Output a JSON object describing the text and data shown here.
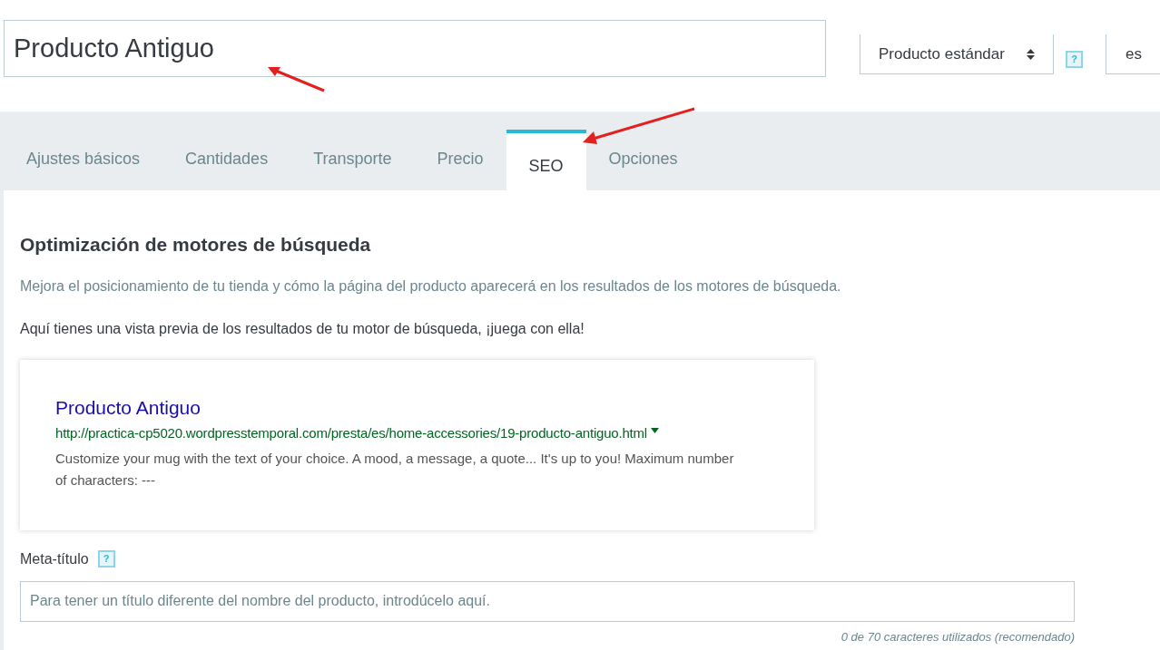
{
  "product_name": {
    "value": "Producto Antiguo"
  },
  "product_type": {
    "value": "Producto estándar",
    "help": "?"
  },
  "language": {
    "value": "es"
  },
  "tabs": [
    {
      "label": "Ajustes básicos",
      "selected": false
    },
    {
      "label": "Cantidades",
      "selected": false
    },
    {
      "label": "Transporte",
      "selected": false
    },
    {
      "label": "Precio",
      "selected": false
    },
    {
      "label": "SEO",
      "selected": true
    },
    {
      "label": "Opciones",
      "selected": false
    }
  ],
  "seo": {
    "heading": "Optimización de motores de búsqueda",
    "description": "Mejora el posicionamiento de tu tienda y cómo la página del producto aparecerá en los resultados de los motores de búsqueda.",
    "preview_intro": "Aquí tienes una vista previa de los resultados de tu motor de búsqueda, ¡juega con ella!",
    "preview": {
      "title": "Producto Antiguo",
      "url": "http://practica-cp5020.wordpresstemporal.com/presta/es/home-accessories/19-producto-antiguo.html",
      "snippet": "Customize your mug with the text of your choice. A mood, a message, a quote... It's up to you! Maximum number of characters: ---"
    },
    "meta_title": {
      "label": "Meta-título",
      "help": "?",
      "placeholder": "Para tener un título diferente del nombre del producto, introdúcelo aquí.",
      "counter": "0 de 70 caracteres utilizados (recomendado)"
    }
  }
}
